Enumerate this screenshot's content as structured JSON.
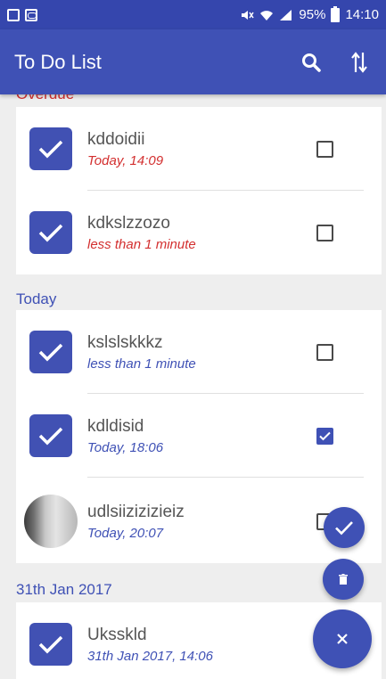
{
  "status_bar": {
    "battery": "95%",
    "time": "14:10"
  },
  "app_bar": {
    "title": "To Do List",
    "search_icon": "search-icon",
    "sort_icon": "sort-icon"
  },
  "groups": [
    {
      "label": "Overdue",
      "color": "#d32f2f",
      "items": [
        {
          "name": "kddoidii",
          "time": "Today, 14:09",
          "checked": false
        },
        {
          "name": "kdkslzzozo",
          "time": "less than 1 minute",
          "checked": false
        }
      ]
    },
    {
      "label": "Today",
      "color": "#3f51b5",
      "items": [
        {
          "name": "kslslskkkz",
          "time": "less than 1 minute",
          "checked": false
        },
        {
          "name": "kdldisid",
          "time": "Today, 18:06",
          "checked": true
        },
        {
          "name": "udlsiizizizieiz",
          "time": "Today, 20:07",
          "checked": false,
          "avatar": "photo"
        }
      ]
    },
    {
      "label": "31th Jan 2017",
      "color": "#3f51b5",
      "items": [
        {
          "name": "Uksskld",
          "time": "31th Jan 2017, 14:06",
          "checked": false
        }
      ]
    }
  ],
  "fabs": {
    "check": "check-icon",
    "trash": "trash-icon",
    "close": "close-icon"
  },
  "colors": {
    "primary": "#3f51b5",
    "primary_dark": "#3546ad",
    "overdue": "#d32f2f"
  }
}
